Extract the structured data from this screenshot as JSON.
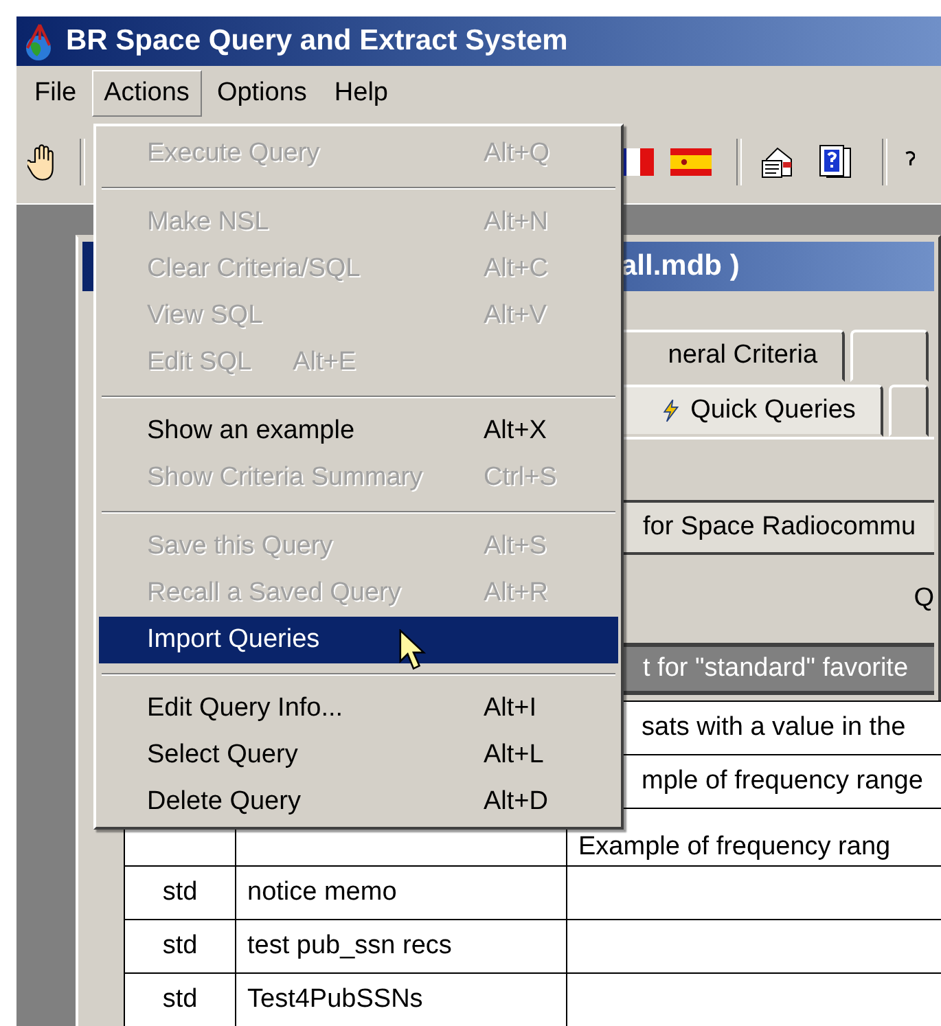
{
  "window": {
    "title": "BR Space Query and Extract System"
  },
  "menubar": [
    {
      "label": "File",
      "selected": false
    },
    {
      "label": "Actions",
      "selected": true
    },
    {
      "label": "Options",
      "selected": false
    },
    {
      "label": "Help",
      "selected": false
    }
  ],
  "actions_menu": [
    {
      "kind": "item",
      "label": "Execute Query",
      "shortcut": "Alt+Q",
      "disabled": true,
      "selected": false
    },
    {
      "kind": "separator"
    },
    {
      "kind": "item",
      "label": "Make NSL",
      "shortcut": "Alt+N",
      "disabled": true,
      "selected": false
    },
    {
      "kind": "item",
      "label": "Clear Criteria/SQL",
      "shortcut": "Alt+C",
      "disabled": true,
      "selected": false
    },
    {
      "kind": "item",
      "label": "View SQL",
      "shortcut": "Alt+V",
      "disabled": true,
      "selected": false
    },
    {
      "kind": "inline",
      "label": "Edit SQL",
      "shortcut": "Alt+E",
      "disabled": true,
      "selected": false
    },
    {
      "kind": "separator"
    },
    {
      "kind": "item",
      "label": "Show an example",
      "shortcut": "Alt+X",
      "disabled": false,
      "selected": false
    },
    {
      "kind": "item",
      "label": "Show Criteria Summary",
      "shortcut": "Ctrl+S",
      "disabled": true,
      "selected": false
    },
    {
      "kind": "separator"
    },
    {
      "kind": "item",
      "label": "Save this Query",
      "shortcut": "Alt+S",
      "disabled": true,
      "selected": false
    },
    {
      "kind": "item",
      "label": "Recall a Saved Query",
      "shortcut": "Alt+R",
      "disabled": true,
      "selected": false
    },
    {
      "kind": "item",
      "label": "Import Queries",
      "disabled": false,
      "selected": true
    },
    {
      "kind": "separator"
    },
    {
      "kind": "item",
      "label": "Edit Query Info...",
      "shortcut": "Alt+I",
      "disabled": false,
      "selected": false
    },
    {
      "kind": "item",
      "label": "Select Query",
      "shortcut": "Alt+L",
      "disabled": false,
      "selected": false
    },
    {
      "kind": "item",
      "label": "Delete Query",
      "shortcut": "Alt+D",
      "disabled": false,
      "selected": false
    }
  ],
  "child_window": {
    "title": "all.mdb )"
  },
  "tabs": [
    [
      {
        "label": "neral Criteria",
        "selected": false
      },
      {
        "selected": false
      }
    ],
    [
      {
        "label": "Quick Queries",
        "selected": true
      },
      {
        "selected": false
      }
    ]
  ],
  "group_title": "for Space Radiocommu",
  "label_q": "Q",
  "table": {
    "caption": "t for \"standard\" favorite",
    "rows": [
      [
        "",
        "",
        "sats with a value in the"
      ],
      [
        "",
        "",
        "mple of frequency range"
      ],
      [
        "",
        "",
        "Example of frequency rang"
      ],
      [
        "std",
        "notice memo",
        ""
      ],
      [
        "std",
        "test pub_ssn recs",
        ""
      ],
      [
        "std",
        "Test4PubSSNs",
        ""
      ]
    ]
  }
}
